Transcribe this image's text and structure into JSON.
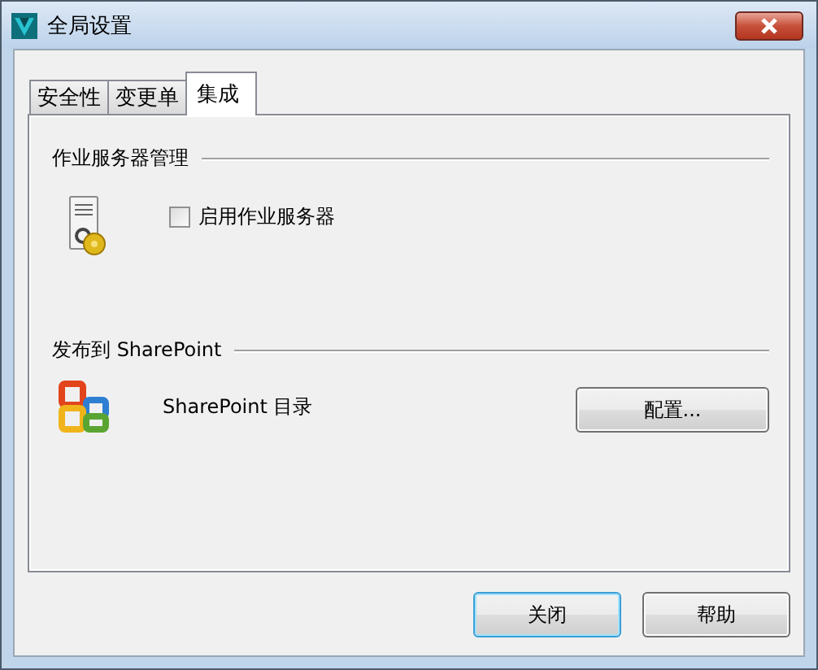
{
  "window": {
    "title": "全局设置"
  },
  "tabs": [
    {
      "label": "安全性",
      "selected": false
    },
    {
      "label": "变更单",
      "selected": false
    },
    {
      "label": "集成",
      "selected": true
    }
  ],
  "sections": [
    {
      "title": "作业服务器管理",
      "kind": "checkbox",
      "label": "启用作业服务器",
      "checked": false
    },
    {
      "title": "发布到 SharePoint",
      "kind": "publish",
      "label": "SharePoint 目录",
      "button": "配置..."
    }
  ],
  "buttons": [
    {
      "label": "关闭",
      "default": true
    },
    {
      "label": "帮助",
      "default": false
    }
  ]
}
